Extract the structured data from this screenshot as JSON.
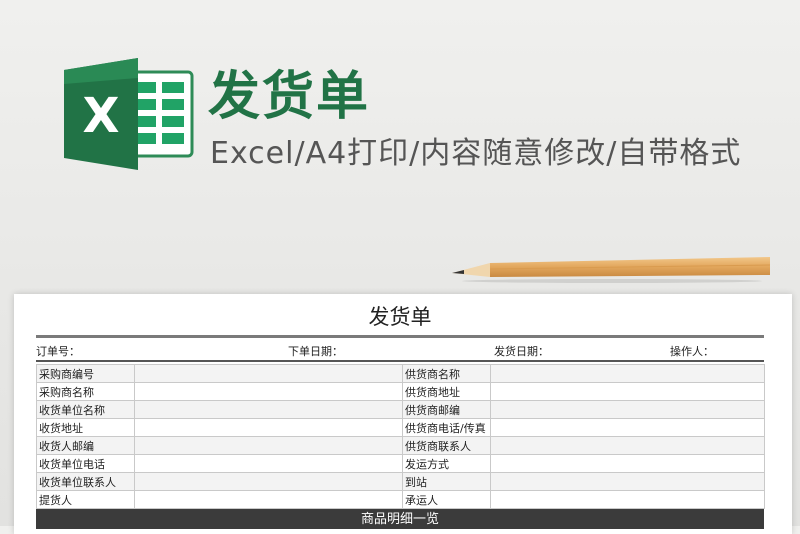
{
  "header": {
    "logo_letter": "X",
    "title": "发货单",
    "subtitle": "Excel/A4打印/内容随意修改/自带格式"
  },
  "colors": {
    "excel_green": "#217346",
    "excel_dark_green": "#185c37",
    "subtitle_gray": "#555555",
    "detail_bar": "#3b3b3b"
  },
  "icons": {
    "logo": "excel-logo-icon",
    "decor": "pencil-icon"
  },
  "sheet": {
    "title": "发货单",
    "meta": {
      "order_no": "订单号：",
      "order_date": "下单日期：",
      "ship_date": "发货日期：",
      "operator": "操作人："
    },
    "rows": [
      {
        "left": "采购商编号",
        "right": "供货商名称"
      },
      {
        "left": "采购商名称",
        "right": "供货商地址"
      },
      {
        "left": "收货单位名称",
        "right": "供货商邮编"
      },
      {
        "left": "收货地址",
        "right": "供货商电话/传真"
      },
      {
        "left": "收货人邮编",
        "right": "供货商联系人"
      },
      {
        "left": "收货单位电话",
        "right": "发运方式"
      },
      {
        "left": "收货单位联系人",
        "right": "到站"
      },
      {
        "left": "提货人",
        "right": "承运人"
      }
    ],
    "detail_header": "商品明细一览"
  }
}
